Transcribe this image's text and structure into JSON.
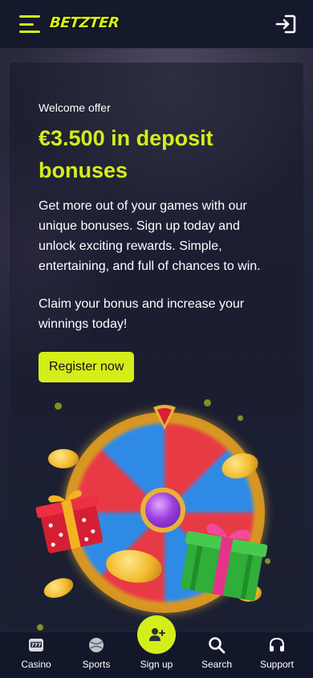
{
  "header": {
    "logo_text": "BETZTER",
    "menu_icon": "hamburger-menu-icon",
    "login_icon": "login-arrow-icon"
  },
  "hero": {
    "eyebrow": "Welcome offer",
    "headline": "€3.500 in deposit bonuses",
    "paragraph_1": "Get more out of your games with our unique bonuses. Sign up today and unlock exciting rewards. Simple, entertaining, and full of chances to win.",
    "paragraph_2": "Claim your bonus and increase your winnings today!",
    "cta_label": "Register now",
    "illustration": "prize-wheel-with-gifts-and-coins"
  },
  "bottom_nav": {
    "items": [
      {
        "label": "Casino",
        "icon": "slot-machine-icon"
      },
      {
        "label": "Sports",
        "icon": "ball-icon"
      },
      {
        "label": "Sign up",
        "icon": "add-user-icon"
      },
      {
        "label": "Search",
        "icon": "search-icon"
      },
      {
        "label": "Support",
        "icon": "headset-icon"
      }
    ]
  },
  "colors": {
    "accent": "#d4ee1a",
    "background": "#141a2b",
    "nav_background": "#121829",
    "text": "#ffffff"
  }
}
